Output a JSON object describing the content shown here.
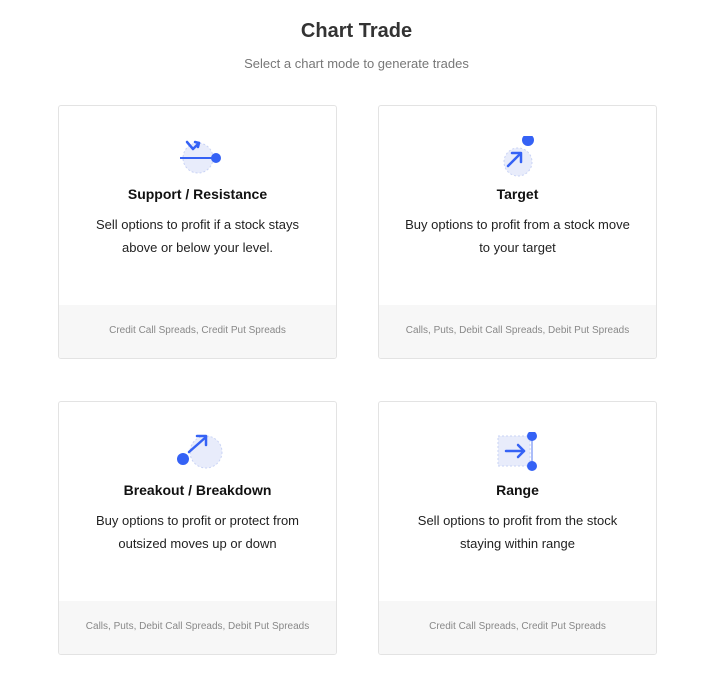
{
  "header": {
    "title": "Chart Trade",
    "subtitle": "Select a chart mode to generate trades"
  },
  "colors": {
    "accent": "#3562f5",
    "icon_bg": "#e8ecfb",
    "footer_bg": "#f7f7f7"
  },
  "cards": [
    {
      "icon": "support-resistance-icon",
      "title": "Support / Resistance",
      "description": "Sell options to profit if a stock stays above or below your level.",
      "strategies": "Credit Call Spreads, Credit Put Spreads"
    },
    {
      "icon": "target-icon",
      "title": "Target",
      "description": "Buy options to profit from a stock move to your target",
      "strategies": "Calls, Puts, Debit Call Spreads, Debit Put Spreads"
    },
    {
      "icon": "breakout-breakdown-icon",
      "title": "Breakout / Breakdown",
      "description": "Buy options to profit or protect from outsized moves up or down",
      "strategies": "Calls, Puts, Debit Call Spreads, Debit Put Spreads"
    },
    {
      "icon": "range-icon",
      "title": "Range",
      "description": "Sell options to profit from the stock staying within range",
      "strategies": "Credit Call Spreads, Credit Put Spreads"
    }
  ]
}
